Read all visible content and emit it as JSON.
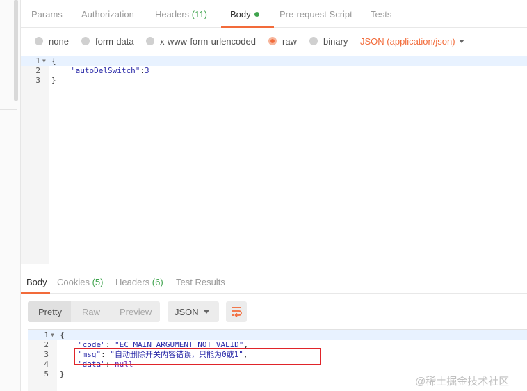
{
  "request_tabs": [
    {
      "label": "Params"
    },
    {
      "label": "Authorization"
    },
    {
      "label": "Headers",
      "count": "(11)"
    },
    {
      "label": "Body"
    },
    {
      "label": "Pre-request Script"
    },
    {
      "label": "Tests"
    }
  ],
  "body_options": [
    {
      "label": "none",
      "selected": false
    },
    {
      "label": "form-data",
      "selected": false
    },
    {
      "label": "x-www-form-urlencoded",
      "selected": false
    },
    {
      "label": "raw",
      "selected": true
    },
    {
      "label": "binary",
      "selected": false
    }
  ],
  "content_type": "JSON (application/json)",
  "request_body": {
    "lines": [
      {
        "num": "1",
        "text": "{"
      },
      {
        "num": "2",
        "key": "\"autoDelSwitch\"",
        "sep": ":",
        "value": "3"
      },
      {
        "num": "3",
        "text": "}"
      }
    ]
  },
  "response_tabs": [
    {
      "label": "Body"
    },
    {
      "label": "Cookies",
      "count": "(5)"
    },
    {
      "label": "Headers",
      "count": "(6)"
    },
    {
      "label": "Test Results"
    }
  ],
  "view_modes": [
    "Pretty",
    "Raw",
    "Preview"
  ],
  "active_view": "Pretty",
  "format": "JSON",
  "response_body": {
    "lines": [
      {
        "num": "1",
        "text": "{"
      },
      {
        "num": "2",
        "key": "\"code\"",
        "sep": ": ",
        "value": "\"EC_MAIN_ARGUMENT_NOT_VALID\"",
        "tail": ","
      },
      {
        "num": "3",
        "key": "\"msg\"",
        "sep": ": ",
        "value": "\"自动删除开关内容错误，只能为0或1\"",
        "tail": ","
      },
      {
        "num": "4",
        "key": "\"data\"",
        "sep": ": ",
        "value": "null"
      },
      {
        "num": "5",
        "text": "}"
      }
    ]
  },
  "watermark": "@稀土掘金技术社区",
  "colors": {
    "accent": "#f26b3a",
    "count_green": "#3fa34d",
    "highlight_red": "#e0242a"
  }
}
